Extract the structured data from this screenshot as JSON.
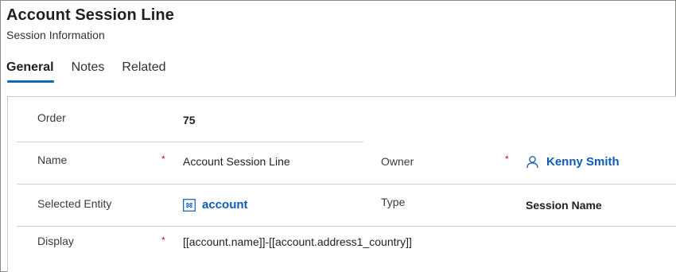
{
  "header": {
    "title": "Account Session Line",
    "subtitle": "Session Information"
  },
  "tabs": [
    {
      "label": "General",
      "active": true
    },
    {
      "label": "Notes",
      "active": false
    },
    {
      "label": "Related",
      "active": false
    }
  ],
  "form": {
    "order": {
      "label": "Order",
      "value": "75"
    },
    "name": {
      "label": "Name",
      "required": "*",
      "value": "Account Session Line"
    },
    "owner": {
      "label": "Owner",
      "required": "*",
      "value": "Kenny Smith",
      "icon": "user-icon"
    },
    "selected_entity": {
      "label": "Selected Entity",
      "value": "account",
      "icon": "entity-icon"
    },
    "type": {
      "label": "Type",
      "value": "Session Name"
    },
    "display": {
      "label": "Display",
      "required": "*",
      "value": "[[account.name]]-[[account.address1_country]]"
    }
  },
  "colors": {
    "accent": "#0f6cbd",
    "link": "#0f5cb5",
    "required": "#c50f1f"
  }
}
